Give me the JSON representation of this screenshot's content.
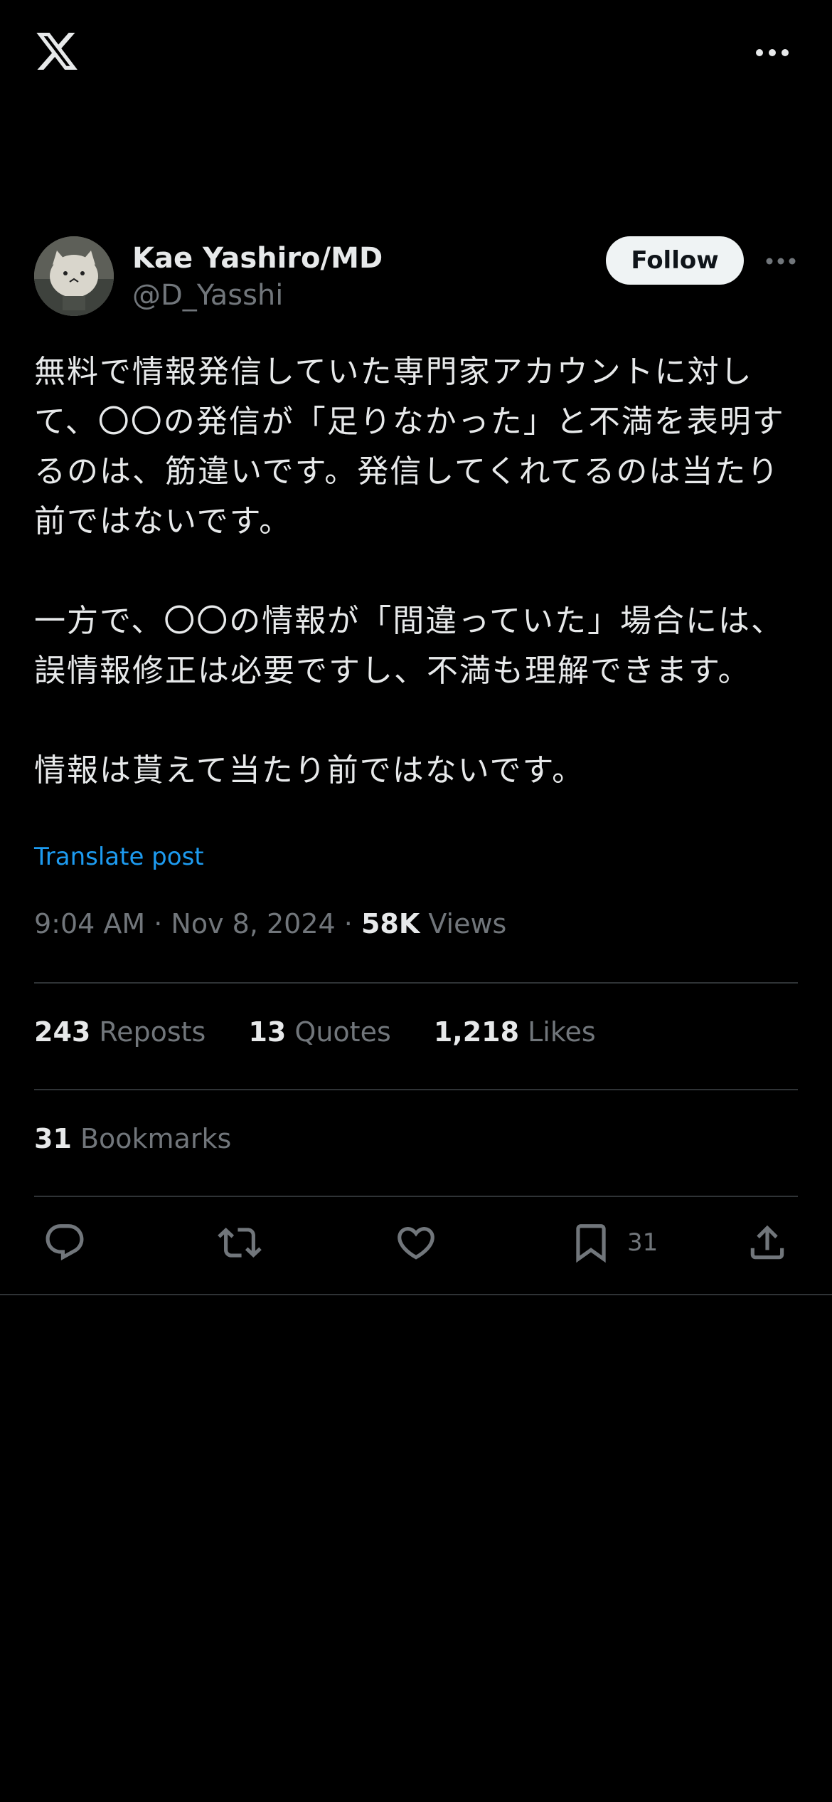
{
  "app": {
    "logo_icon": "x-logo-icon",
    "more_icon": "more-horizontal-icon"
  },
  "author": {
    "name": "Kae Yashiro/MD",
    "handle": "@D_Yasshi",
    "follow_label": "Follow",
    "avatar_icon": "avatar-cat-plush"
  },
  "post": {
    "text": "無料で情報発信していた専門家アカウントに対して、〇〇の発信が「足りなかった」と不満を表明するのは、筋違いです。発信してくれてるのは当たり前ではないです。\n\n一方で、〇〇の情報が「間違っていた」場合には、誤情報修正は必要ですし、不満も理解できます。\n\n情報は貰えて当たり前ではないです。",
    "translate_label": "Translate post",
    "timestamp": "9:04 AM · Nov 8, 2024 · ",
    "views_count": "58K",
    "views_label": " Views"
  },
  "stats": {
    "reposts_count": "243",
    "reposts_label": " Reposts",
    "quotes_count": "13",
    "quotes_label": " Quotes",
    "likes_count": "1,218",
    "likes_label": " Likes",
    "bookmarks_count": "31",
    "bookmarks_label": " Bookmarks"
  },
  "actions": {
    "reply_icon": "reply-icon",
    "repost_icon": "repost-icon",
    "like_icon": "like-icon",
    "bookmark_icon": "bookmark-icon",
    "bookmark_count": "31",
    "share_icon": "share-icon"
  },
  "colors": {
    "background": "#000000",
    "text_primary": "#e7e9ea",
    "text_secondary": "#71767b",
    "link": "#1d9bf0",
    "divider": "#2f3336",
    "follow_bg": "#eff3f4"
  }
}
